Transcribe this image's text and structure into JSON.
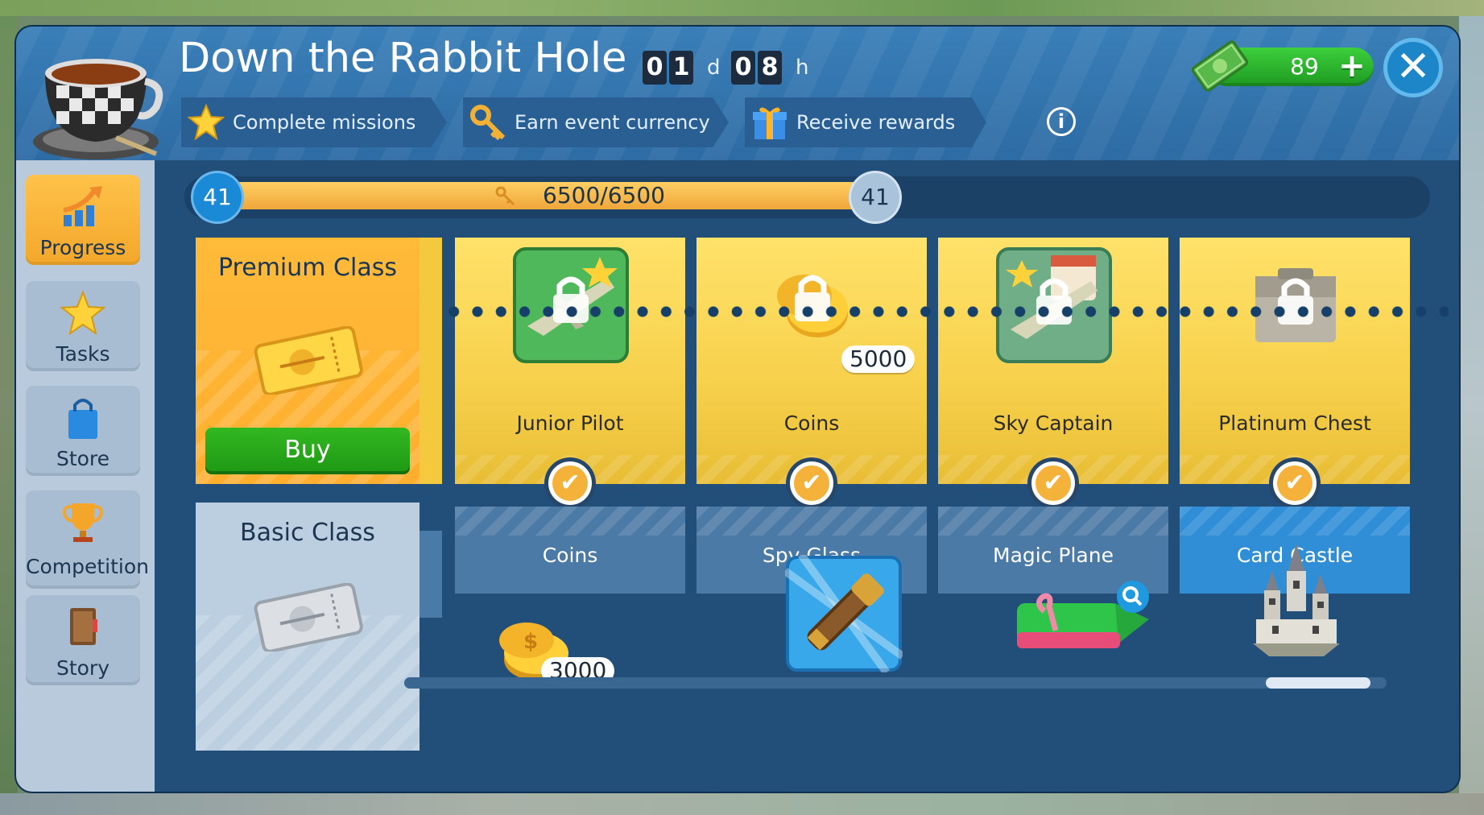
{
  "event": {
    "title": "Down the Rabbit Hole",
    "timer": {
      "days": [
        "0",
        "1"
      ],
      "day_unit": "d",
      "hours": [
        "0",
        "8"
      ],
      "hour_unit": "h"
    }
  },
  "steps": [
    {
      "label": "Complete missions",
      "icon": "star-icon"
    },
    {
      "label": "Earn event currency",
      "icon": "key-icon"
    },
    {
      "label": "Receive rewards",
      "icon": "gift-icon"
    }
  ],
  "currency": {
    "amount": "89",
    "icon": "cash-icon"
  },
  "sidebar": {
    "tabs": [
      {
        "label": "Progress",
        "icon": "progress-arrow-icon",
        "active": true
      },
      {
        "label": "Tasks",
        "icon": "star-icon",
        "active": false
      },
      {
        "label": "Store",
        "icon": "shopping-bag-icon",
        "active": false
      },
      {
        "label": "Competition",
        "icon": "trophy-icon",
        "active": false
      },
      {
        "label": "Story",
        "icon": "book-icon",
        "active": false
      }
    ]
  },
  "progress": {
    "level_current": "41",
    "level_next": "41",
    "value_text": "6500/6500",
    "fraction": 1.0
  },
  "premium": {
    "title": "Premium Class",
    "buy_label": "Buy"
  },
  "basic": {
    "title": "Basic Class"
  },
  "premium_rewards": [
    {
      "label": "Junior Pilot",
      "locked": true
    },
    {
      "label": "Coins",
      "locked": true,
      "count": "5000"
    },
    {
      "label": "Sky Captain",
      "locked": true
    },
    {
      "label": "Platinum Chest",
      "locked": true
    }
  ],
  "basic_rewards": [
    {
      "label": "Coins",
      "count": "3000"
    },
    {
      "label": "Spy Glass"
    },
    {
      "label": "Magic Plane"
    },
    {
      "label": "Card Castle",
      "highlighted": true
    }
  ],
  "colors": {
    "accent": "#f4b23a",
    "panel": "#224f7a",
    "buy": "#25a819",
    "highlight": "#2f8ed6"
  }
}
